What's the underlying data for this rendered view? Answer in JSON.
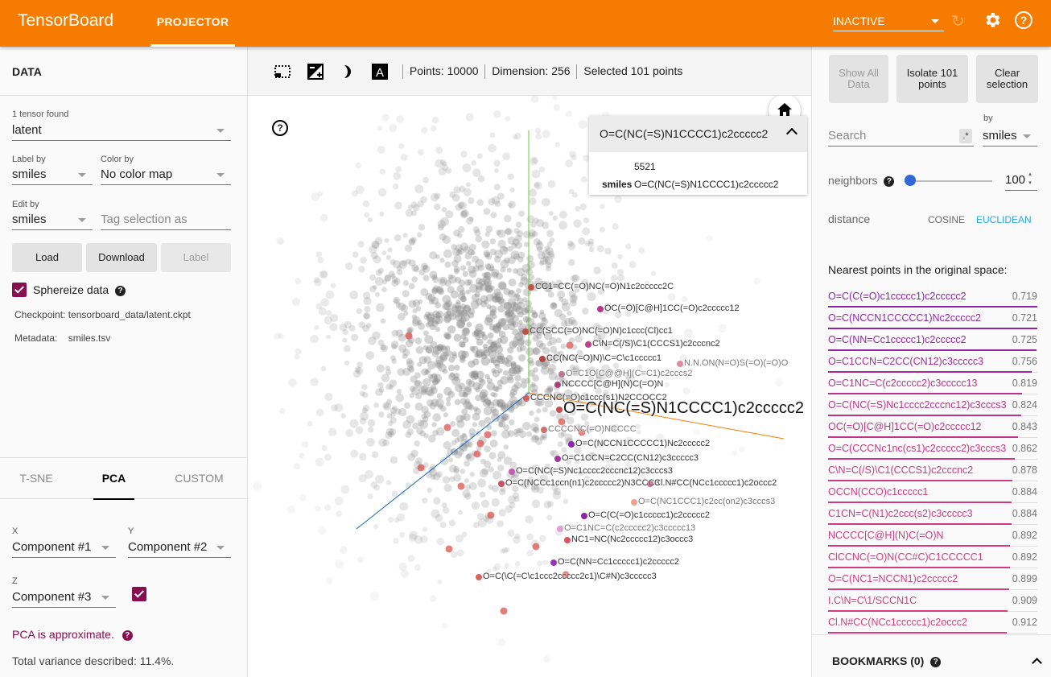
{
  "header": {
    "brand": "TensorBoard",
    "active_tab": "PROJECTOR",
    "run_selector": "INACTIVE",
    "icons": [
      "reload-icon",
      "gear-icon",
      "help-icon"
    ],
    "accent_color": "#f57c00"
  },
  "data_panel": {
    "title": "DATA",
    "tensor_count_label": "1 tensor found",
    "tensor_value": "latent",
    "label_by_label": "Label by",
    "label_by_value": "smiles",
    "color_by_label": "Color by",
    "color_by_value": "No color map",
    "edit_by_label": "Edit by",
    "edit_by_value": "smiles",
    "tag_placeholder": "Tag selection as",
    "buttons": {
      "load": "Load",
      "download": "Download",
      "label": "Label"
    },
    "sphereize_label": "Sphereize data",
    "sphereize_checked": true,
    "checkpoint_label": "Checkpoint:",
    "checkpoint_value": "tensorboard_data/latent.ckpt",
    "metadata_label": "Metadata:",
    "metadata_value": "smiles.tsv"
  },
  "projection": {
    "tabs": [
      "T-SNE",
      "PCA",
      "CUSTOM"
    ],
    "active_tab": "PCA",
    "x_label": "X",
    "x_value": "Component #1",
    "y_label": "Y",
    "y_value": "Component #2",
    "z_label": "Z",
    "z_value": "Component #3",
    "z_enabled": true,
    "approx_note": "PCA is approximate.",
    "variance": "Total variance described: 11.4%."
  },
  "toolbar": {
    "icons": [
      "select-rectangle-icon",
      "night-mode-icon",
      "moon-icon",
      "labels-icon"
    ],
    "points": "Points: 10000",
    "dimension": "Dimension: 256",
    "selected": "Selected 101 points"
  },
  "point_card": {
    "title": "O=C(NC(=S)N1CCCC1)c2ccccc2",
    "index": "5521",
    "field_key": "smiles",
    "field_value": "O=C(NC(=S)N1CCCC1)c2ccccc2"
  },
  "scene": {
    "axis_colors": {
      "x": "#f57c00",
      "y": "#66cc33",
      "z": "#1565c0"
    },
    "labels": [
      {
        "text": "CC1=CC(=O)NC(=O)N1c2ccccc2C",
        "style": "normal"
      },
      {
        "text": "OC(=O)[C@H]1CC(=O)c2ccccc12",
        "style": "normal"
      },
      {
        "text": "CC(SCC(=O)NC(=O)N)c1ccc(Cl)cc1",
        "style": "normal"
      },
      {
        "text": "C\\N=C(/S)\\C1(CCCS1)c2cccnc2",
        "style": "normal"
      },
      {
        "text": "CC(NC(=O)N)\\C=C\\c1ccccc1",
        "style": "normal"
      },
      {
        "text": "N.N.ON(N=O)S(=O)(=O)O",
        "style": "faint"
      },
      {
        "text": "O=C1O[C@@H](C=C1)c2cccs2",
        "style": "faint"
      },
      {
        "text": "NCCCC[C@H](N)C(=O)N",
        "style": "normal"
      },
      {
        "text": "CCCNC(=O)c1ccc(s1)N2CCOCC2",
        "style": "normal"
      },
      {
        "text": "O=C(NC(=S)N1CCCC1)c2ccccc2",
        "style": "big"
      },
      {
        "text": "CCCCNC(=O)NCCCC",
        "style": "faint"
      },
      {
        "text": "O=C(NCCN1CCCCC1)Nc2ccccc2",
        "style": "normal"
      },
      {
        "text": "O=C1CCN=C2CC(CN12)c3ccccc3",
        "style": "normal"
      },
      {
        "text": "O=C(NC(=S)Nc1cccc2cccnc12)c3cccs3",
        "style": "normal"
      },
      {
        "text": "O=C(NCCc1ccn(n1)c2ccccc2)N3CCC3",
        "style": "normal"
      },
      {
        "text": "Cl.N#CC(NCc1ccccc1)c2occc2",
        "style": "normal"
      },
      {
        "text": "O=C(NC1CCC1)c2cc(on2)c3cccs3",
        "style": "faint"
      },
      {
        "text": "O=C(C(=O)c1ccccc1)c2ccccc2",
        "style": "normal"
      },
      {
        "text": "O=C1NC=C(c2ccccc2)c3ccccc13",
        "style": "faint"
      },
      {
        "text": "NC1=NC(Nc2ccccc12)c3occc3",
        "style": "normal"
      },
      {
        "text": "O=C(NN=Cc1ccccc1)c2ccccc2",
        "style": "normal"
      },
      {
        "text": "O=C(\\C(=C\\c1ccc2ccccc2c1)\\C#N)c3ccccc3",
        "style": "normal"
      }
    ]
  },
  "inspector": {
    "buttons": {
      "show_all": "Show All Data",
      "isolate": "Isolate 101 points",
      "clear": "Clear selection"
    },
    "search_placeholder": "Search",
    "regex_label": ".*",
    "by_label": "by",
    "by_value": "smiles",
    "neighbors_label": "neighbors",
    "neighbors_value": "100",
    "neighbors_slider_fraction": 0.05,
    "distance_label": "distance",
    "distance_options": [
      "COSINE",
      "EUCLIDEAN"
    ],
    "distance_selected": "EUCLIDEAN",
    "nearest_title": "Nearest points in the original space:",
    "nearest": [
      {
        "label": "O=C(C(=O)c1ccccc1)c2ccccc2",
        "value": "0.719",
        "color": "#8e24aa"
      },
      {
        "label": "O=C(NCCN1CCCCC1)Nc2ccccc2",
        "value": "0.721",
        "color": "#9027a6"
      },
      {
        "label": "O=C(NN=Cc1ccccc1)c2ccccc2",
        "value": "0.725",
        "color": "#9429a2"
      },
      {
        "label": "O=C1CCN=C2CC(CN12)c3ccccc3",
        "value": "0.756",
        "color": "#a02d98"
      },
      {
        "label": "O=C1NC=C(c2ccccc2)c3ccccc13",
        "value": "0.819",
        "color": "#b9328a"
      },
      {
        "label": "O=C(NC(=S)Nc1cccc2cccnc12)c3cccs3",
        "value": "0.824",
        "color": "#bb3388"
      },
      {
        "label": "OC(=O)[C@H]1CC(=O)c2ccccc12",
        "value": "0.843",
        "color": "#c13584"
      },
      {
        "label": "O=C(CCCNc1nc(cs1)c2ccccc2)c3cccs3",
        "value": "0.862",
        "color": "#c73782"
      },
      {
        "label": "C\\N=C(/S)\\C1(CCCS1)c2cccnc2",
        "value": "0.878",
        "color": "#cc3a80"
      },
      {
        "label": "OCCN(CCO)c1ccccc1",
        "value": "0.884",
        "color": "#ce3b7f"
      },
      {
        "label": "C1CN=C(N1)c2ccc(s2)c3ccccc3",
        "value": "0.884",
        "color": "#ce3b7f"
      },
      {
        "label": "NCCCC[C@H](N)C(=O)N",
        "value": "0.892",
        "color": "#d03c7e"
      },
      {
        "label": "ClCCNC(=O)N(CC#C)C1CCCCC1",
        "value": "0.892",
        "color": "#d03c7e"
      },
      {
        "label": "O=C(NC1=NCCN1)c2ccccc2",
        "value": "0.899",
        "color": "#d23d7d"
      },
      {
        "label": "I.C\\N=C\\1/SCCN1C",
        "value": "0.909",
        "color": "#d43e7c"
      },
      {
        "label": "Cl.N#CC(NCc1ccccc1)c2occc2",
        "value": "0.912",
        "color": "#d63f7b"
      }
    ],
    "bookmarks_title": "BOOKMARKS (0)"
  }
}
